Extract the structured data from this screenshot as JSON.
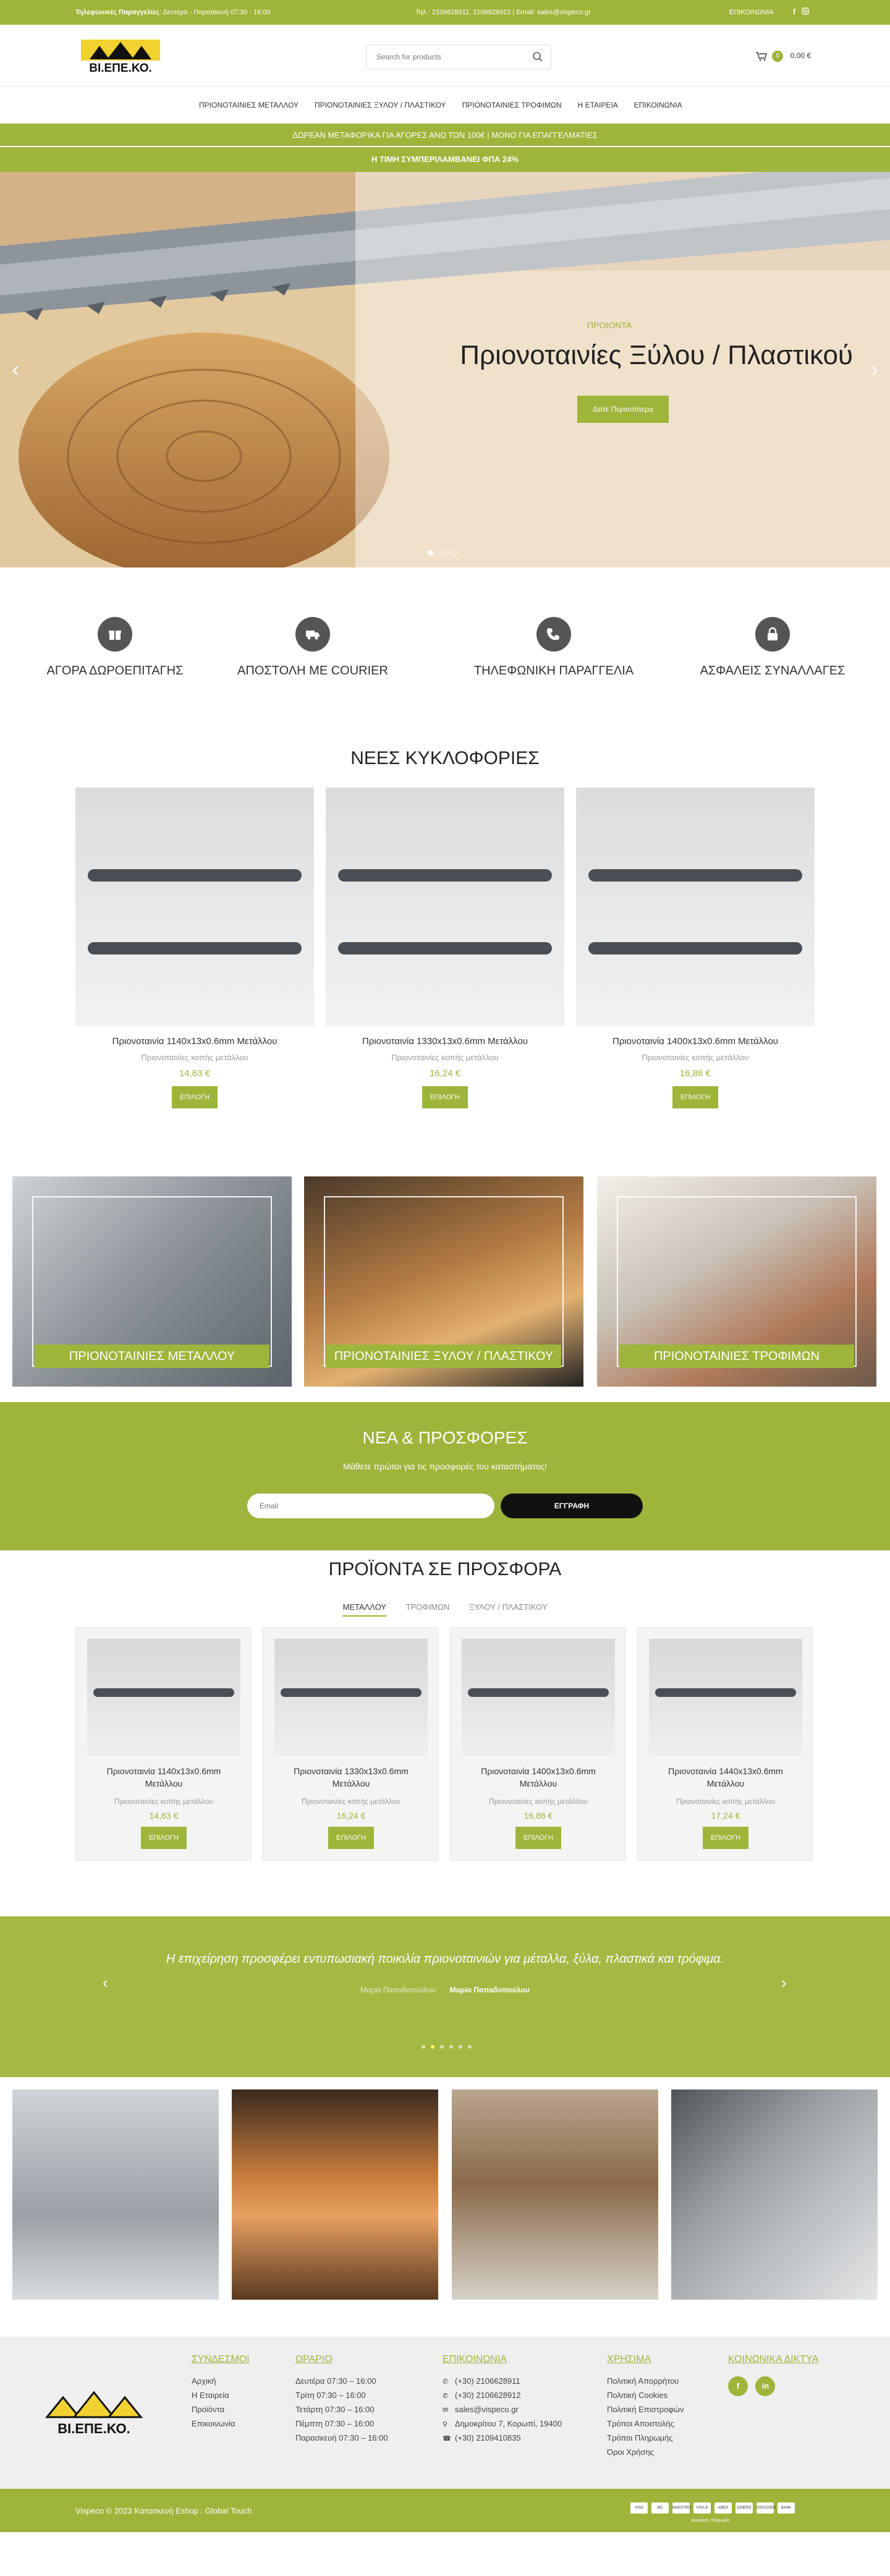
{
  "topbar": {
    "hours_label": "Τηλεφωνικές Παραγγελίες",
    "hours_text": ": Δευτέρα - Παρασκευή 07:30 - 16:00",
    "contact": "Τηλ.: 2106628911, 2106628912 | Email: sales@vispeco.gr",
    "link": "ΕΠΙΚΟΙΝΩΝΙΑ",
    "social": [
      "facebook-icon",
      "instagram-icon"
    ]
  },
  "header": {
    "logo_text": "ΒΙ.ΕΠΕ.ΚΟ.",
    "search_placeholder": "Search for products",
    "cart_count": "0",
    "cart_total": "0,00 €"
  },
  "nav": {
    "items": [
      "ΠΡΙΟΝΟΤΑΙΝΙΕΣ ΜΕΤΑΛΛΟΥ",
      "ΠΡΙΟΝΟΤΑΙΝΙΕΣ ΞΥΛΟΥ / ΠΛΑΣΤΙΚΟΥ",
      "ΠΡΙΟΝΟΤΑΙΝΙΕΣ ΤΡΟΦΙΜΩΝ",
      "Η ΕΤΑΙΡΕΙΑ",
      "ΕΠΙΚΟΙΝΩΝΙΑ"
    ]
  },
  "promo": {
    "line1": "ΔΩΡΕΑΝ ΜΕΤΑΦΟΡΙΚΑ ΓΙΑ ΑΓΟΡΕΣ ΑΝΩ ΤΩΝ 100€ | ΜΟΝΟ ΓΙΑ ΕΠΑΓΓΕΛΜΑΤΙΕΣ",
    "line2": "Η ΤΙΜΗ ΣΥΜΠΕΡΙΛΑΜΒΑΝΕΙ ΦΠΑ 24%"
  },
  "hero": {
    "kicker": "ΠΡΟΙΟΝΤΑ",
    "title": "Πριονοταινίες Ξύλου / Πλαστικού",
    "cta": "Δείτε Περισσότερα",
    "dots": 3,
    "active_dot": 0
  },
  "features": [
    {
      "icon": "gift-icon",
      "label": "ΑΓΟΡΑ ΔΩΡΟΕΠΙΤΑΓΗΣ"
    },
    {
      "icon": "truck-icon",
      "label": "ΑΠΟΣΤΟΛΗ ΜΕ COURIER"
    },
    {
      "icon": "phone-icon",
      "label": "ΤΗΛΕΦΩΝΙΚΗ ΠΑΡΑΓΓΕΛΙΑ"
    },
    {
      "icon": "lock-icon",
      "label": "ΑΣΦΑΛΕΙΣ ΣΥΝΑΛΛΑΓΕΣ"
    }
  ],
  "new_releases": {
    "title": "ΝΕΕΣ ΚΥΚΛΟΦΟΡΙΕΣ",
    "products": [
      {
        "name": "Πριονοταινία 1140x13x0.6mm Μετάλλου",
        "category": "Πριονοταινίες κοπής μετάλλου",
        "price": "14,63 €",
        "button": "ΕΠΙΛΟΓΗ"
      },
      {
        "name": "Πριονοταινία 1330x13x0.6mm Μετάλλου",
        "category": "Πριονοταινίες κοπής μετάλλου",
        "price": "16,24 €",
        "button": "ΕΠΙΛΟΓΗ"
      },
      {
        "name": "Πριονοταινία 1400x13x0.6mm Μετάλλου",
        "category": "Πριονοταινίες κοπής μετάλλου",
        "price": "16,86 €",
        "button": "ΕΠΙΛΟΓΗ"
      }
    ]
  },
  "categories": [
    {
      "label": "ΠΡΙΟΝΟΤΑΙΝΙΕΣ ΜΕΤΑΛΛΟΥ"
    },
    {
      "label": "ΠΡΙΟΝΟΤΑΙΝΙΕΣ ΞΥΛΟΥ / ΠΛΑΣΤΙΚΟΥ"
    },
    {
      "label": "ΠΡΙΟΝΟΤΑΙΝΙΕΣ ΤΡΟΦΙΜΩΝ"
    }
  ],
  "newsletter": {
    "title": "ΝΕΑ & ΠΡΟΣΦΟΡΕΣ",
    "subtitle": "Μάθετε πρώτοι για τις προσφορές του καταστήματος!",
    "placeholder": "Email",
    "button": "ΕΓΓΡΑΦΗ"
  },
  "offers": {
    "title": "ΠΡΟΪΟΝΤΑ ΣΕ ΠΡΟΣΦΟΡΑ",
    "tabs": [
      "ΜΕΤΑΛΛΟΥ",
      "ΤΡΟΦΙΜΩΝ",
      "ΞΥΛΟΥ / ΠΛΑΣΤΙΚΟΥ"
    ],
    "active_tab": 0,
    "products": [
      {
        "name": "Πριονοταινία 1140x13x0.6mm Μετάλλου",
        "category": "Πριονοταινίες κοπής μετάλλου",
        "price": "14,63 €",
        "button": "ΕΠΙΛΟΓΗ"
      },
      {
        "name": "Πριονοταινία 1330x13x0.6mm Μετάλλου",
        "category": "Πριονοταινίες κοπής μετάλλου",
        "price": "16,24 €",
        "button": "ΕΠΙΛΟΓΗ"
      },
      {
        "name": "Πριονοταινία 1400x13x0.6mm Μετάλλου",
        "category": "Πριονοταινίες κοπής μετάλλου",
        "price": "16,86 €",
        "button": "ΕΠΙΛΟΓΗ"
      },
      {
        "name": "Πριονοταινία 1440x13x0.6mm Μετάλλου",
        "category": "Πριονοταινίες κοπής μετάλλου",
        "price": "17,24 €",
        "button": "ΕΠΙΛΟΓΗ"
      }
    ]
  },
  "testimonial": {
    "quote": "Η επιχείρηση προσφέρει εντυπωσιακή ποικιλία πριονοταινιών για μέταλλα, ξύλα, πλαστικά και τρόφιμα.",
    "image_alt": "Μαρία Παπαδοπούλου",
    "author": "Μαρία Παπαδοπούλου",
    "dots": 6,
    "active_dot": 1
  },
  "footer": {
    "logo_text": "ΒΙ.ΕΠΕ.ΚΟ.",
    "links": {
      "title": "ΣΥΝΔΕΣΜΟΙ",
      "items": [
        "Αρχική",
        "Η Εταιρεία",
        "Προϊόντα",
        "Επικοινωνία"
      ]
    },
    "hours": {
      "title": "ΩΡΑΡΙΟ",
      "items": [
        "Δευτέρα 07:30 – 16:00",
        "Τρίτη 07:30 – 16:00",
        "Τετάρτη 07:30 – 16:00",
        "Πέμπτη 07:30 – 16:00",
        "Παρασκευή 07:30 – 16:00"
      ]
    },
    "contact": {
      "title": "ΕΠΙΚΟΙΝΩΝΙΑ",
      "items": [
        {
          "icon": "phone-icon",
          "text": "(+30) 2106628911"
        },
        {
          "icon": "phone-icon",
          "text": "(+30) 2106628912"
        },
        {
          "icon": "email-icon",
          "text": "sales@vispeco.gr"
        },
        {
          "icon": "location-icon",
          "text": "Δημοκρίτου 7, Κορωπί, 19400"
        },
        {
          "icon": "fax-icon",
          "text": "(+30) 2109410835"
        }
      ]
    },
    "useful": {
      "title": "ΧΡΗΣΙΜΑ",
      "items": [
        "Πολιτική Απορρήτου",
        "Πολιτική Cookies",
        "Πολιτική Επιστροφών",
        "Τρόποι Αποστολής",
        "Τρόποι Πληρωμής",
        "Όροι Χρήσης"
      ]
    },
    "social": {
      "title": "ΚΟΙΝΩΝΙΚΑ ΔΙΚΤΥΑ",
      "items": [
        "facebook-icon",
        "linkedin-icon"
      ]
    },
    "copyright": "Vispeco © 2023 Κατασκευή Eshop : Global Touch",
    "payments": [
      "VISA",
      "MC",
      "MAESTRO",
      "VISA E",
      "AMEX",
      "DINERS",
      "DISCOVER",
      "BANK"
    ],
    "payment_label": "Ασφαλείς Πληρωμές"
  },
  "colors": {
    "accent": "#9db53a",
    "text": "#333333"
  }
}
